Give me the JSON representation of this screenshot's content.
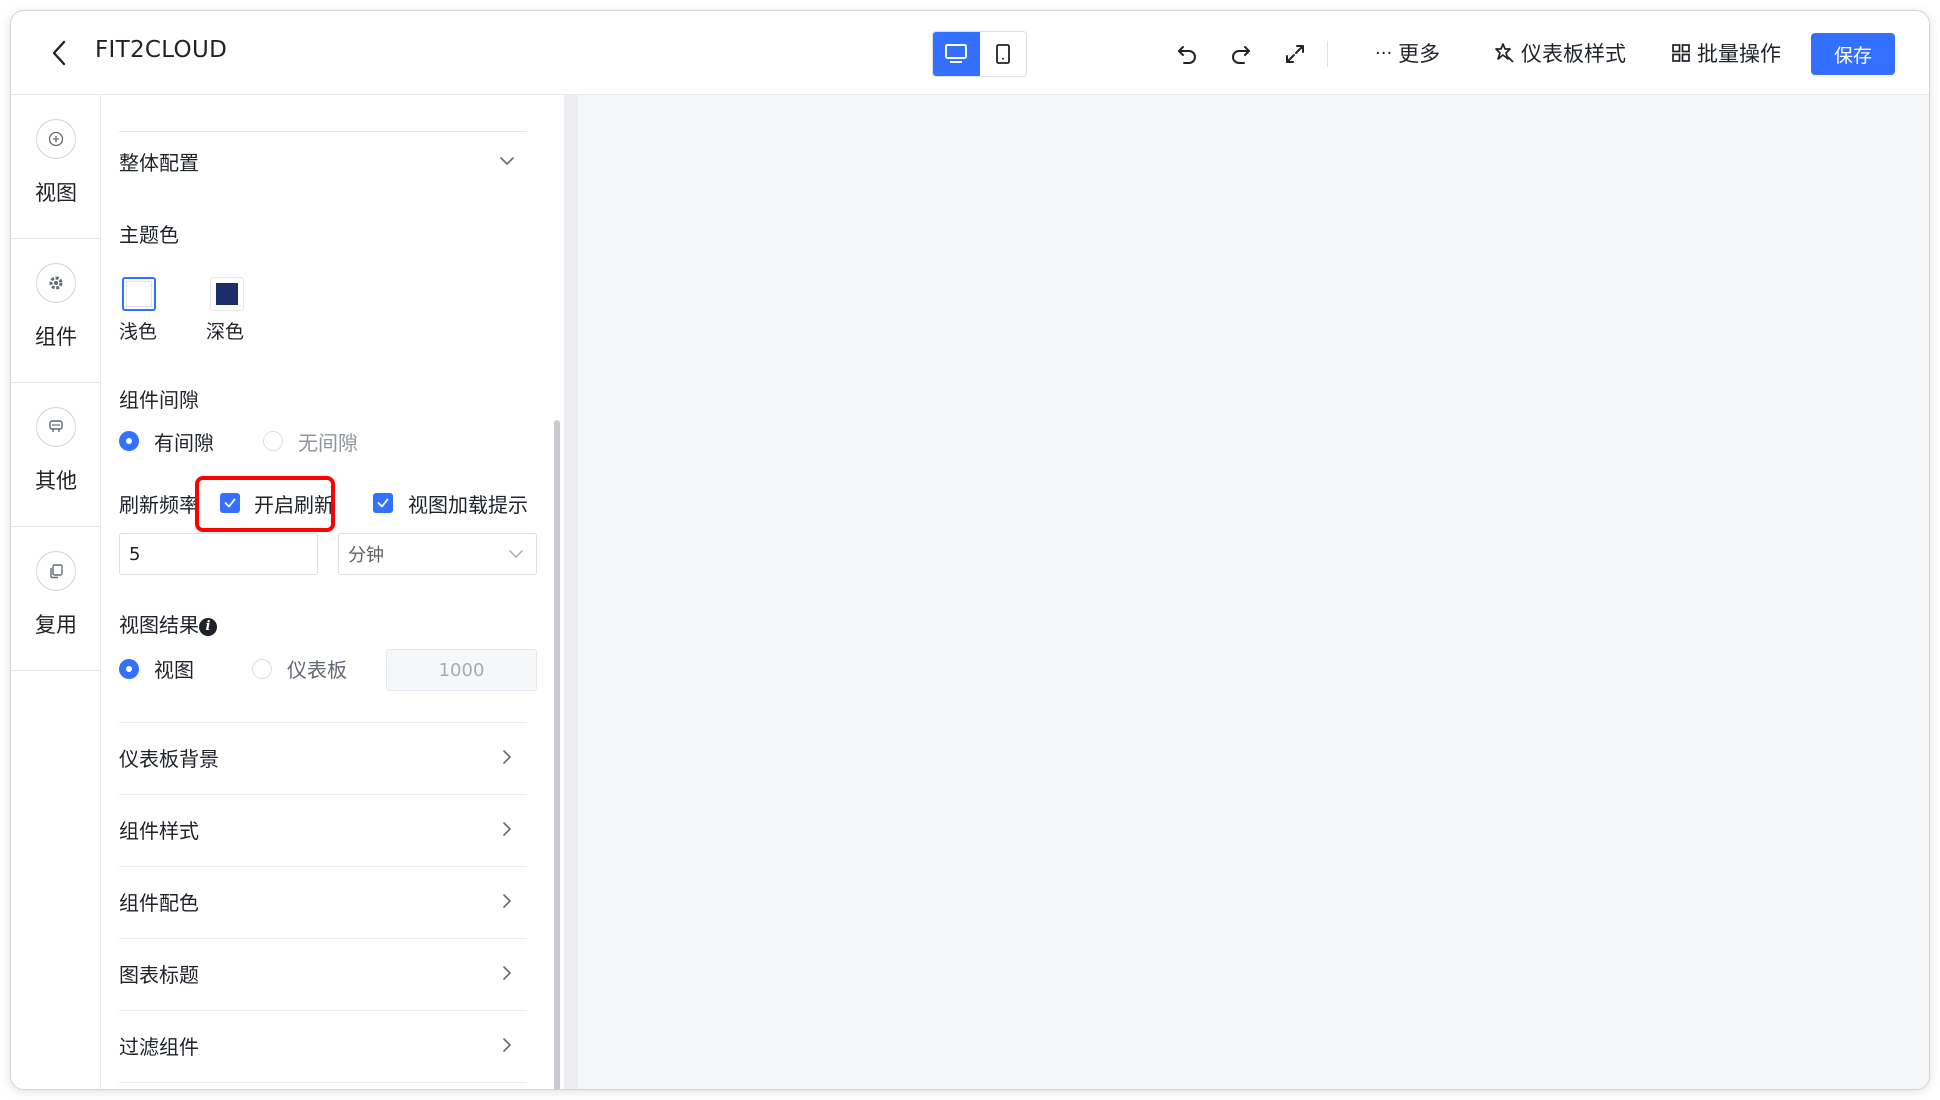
{
  "header": {
    "title": "FIT2CLOUD",
    "more_label": "更多",
    "dashboard_style_label": "仪表板样式",
    "batch_label": "批量操作",
    "save_label": "保存",
    "device_modes": [
      "desktop",
      "mobile"
    ],
    "active_device": "desktop"
  },
  "sidebar": {
    "items": [
      {
        "label": "视图",
        "icon": "plus-circle-icon"
      },
      {
        "label": "组件",
        "icon": "gear-icon"
      },
      {
        "label": "其他",
        "icon": "stamp-icon"
      },
      {
        "label": "复用",
        "icon": "copy-icon"
      }
    ]
  },
  "panel": {
    "overall_config": "整体配置",
    "theme_label": "主题色",
    "theme_light": "浅色",
    "theme_dark": "深色",
    "gap_label": "组件间隙",
    "gap_on": "有间隙",
    "gap_off": "无间隙",
    "refresh_label": "刷新频率",
    "enable_refresh": "开启刷新",
    "view_loading_hint": "视图加载提示",
    "refresh_value": "5",
    "refresh_unit": "分钟",
    "result_label": "视图结果",
    "result_view": "视图",
    "result_dashboard": "仪表板",
    "result_count": "1000",
    "sections": [
      "仪表板背景",
      "组件样式",
      "组件配色",
      "图表标题",
      "过滤组件"
    ]
  },
  "colors": {
    "accent": "#3370ff",
    "dark_theme_swatch": "#1a2e6c",
    "highlight": "#ff0000",
    "canvas_bg": "#f5f6f7"
  }
}
